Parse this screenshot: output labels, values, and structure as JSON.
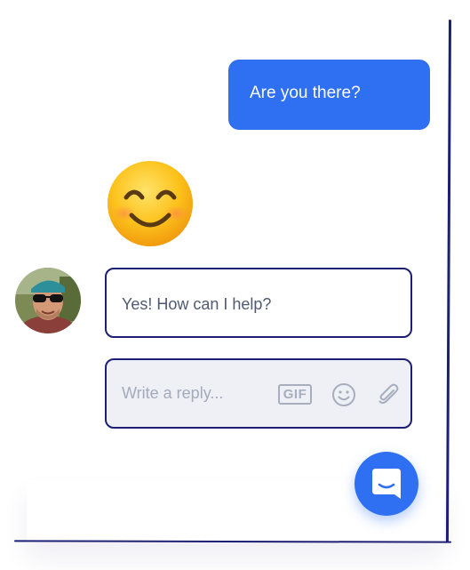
{
  "conversation": {
    "outgoing_message": "Are you there?",
    "reaction_emoji": "smiling-face-with-smiling-eyes",
    "incoming_message": "Yes! How can I help?"
  },
  "composer": {
    "placeholder": "Write a reply...",
    "gif_label": "GIF",
    "emoji_icon": "smiley-icon",
    "attach_icon": "paperclip-icon"
  },
  "launcher": {
    "icon": "chat-bubble-icon"
  },
  "colors": {
    "accent": "#2f6ff2",
    "outline": "#1d1f73",
    "composer_bg": "#eef0f6",
    "icon_gray": "#a7aebd"
  }
}
